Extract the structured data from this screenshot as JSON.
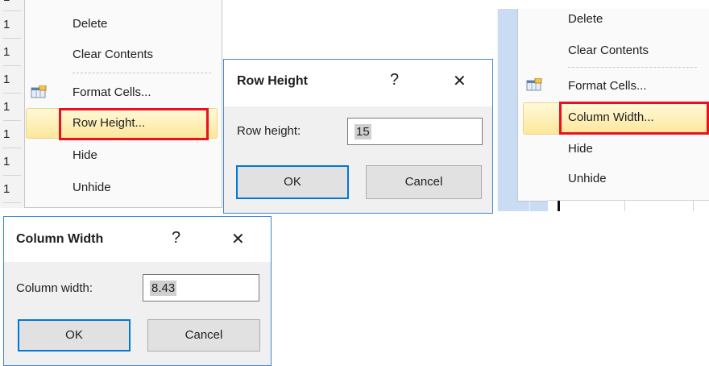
{
  "menu_row": {
    "row_numbers": [
      "1",
      "1",
      "1",
      "1",
      "1",
      "1",
      "1",
      "1"
    ],
    "items": [
      {
        "label": "Delete"
      },
      {
        "label": "Clear Contents"
      },
      {
        "label": "Format Cells..."
      },
      {
        "label": "Row Height..."
      },
      {
        "label": "Hide"
      },
      {
        "label": "Unhide"
      }
    ]
  },
  "row_height_dialog": {
    "title": "Row Height",
    "help": "?",
    "close": "✕",
    "field_label": "Row height:",
    "value": "15",
    "ok": "OK",
    "cancel": "Cancel"
  },
  "menu_column": {
    "items": [
      {
        "label": "Delete"
      },
      {
        "label": "Clear Contents"
      },
      {
        "label": "Format Cells..."
      },
      {
        "label": "Column Width..."
      },
      {
        "label": "Hide"
      },
      {
        "label": "Unhide"
      }
    ]
  },
  "column_width_dialog": {
    "title": "Column Width",
    "help": "?",
    "close": "✕",
    "field_label": "Column width:",
    "value": "8.43",
    "ok": "OK",
    "cancel": "Cancel"
  },
  "colors": {
    "highlight_border": "#e81123",
    "dialog_border": "#3c86d6",
    "default_button_border": "#0078d7"
  },
  "icons": [
    "format-cells-icon",
    "help-icon",
    "close-icon"
  ]
}
